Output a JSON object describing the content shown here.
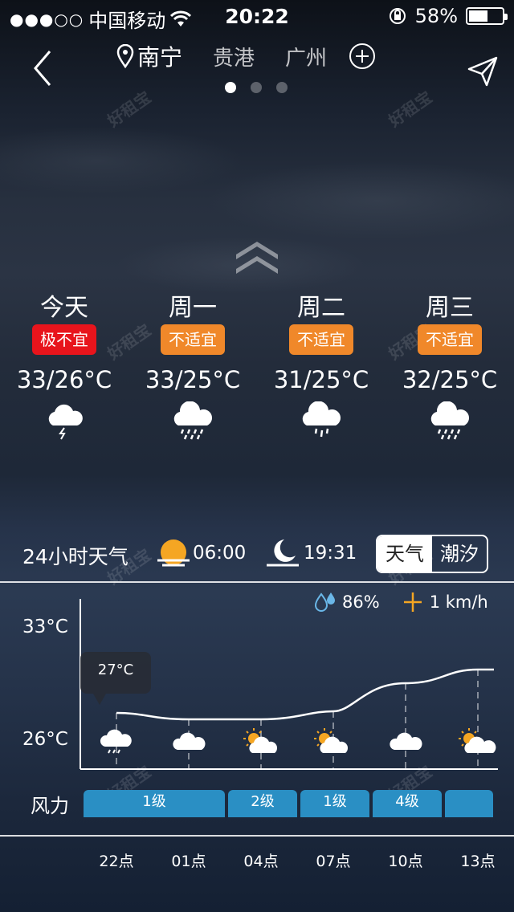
{
  "status_bar": {
    "signal": "●●●○○",
    "carrier": "中国移动",
    "time": "20:22",
    "battery": "58%",
    "battery_level": 0.58
  },
  "nav": {
    "cities": [
      "南宁",
      "贵港",
      "广州"
    ],
    "active_city_index": 0,
    "page_count": 3,
    "active_page": 0
  },
  "forecast": [
    {
      "day": "今天",
      "badge": "极不宜",
      "badge_color": "#e8141c",
      "temp": "33/26°C",
      "icon": "thunderstorm-cloud-icon"
    },
    {
      "day": "周一",
      "badge": "不适宜",
      "badge_color": "#f0882a",
      "temp": "33/25°C",
      "icon": "rain-cloud-icon"
    },
    {
      "day": "周二",
      "badge": "不适宜",
      "badge_color": "#f0882a",
      "temp": "31/25°C",
      "icon": "light-rain-cloud-icon"
    },
    {
      "day": "周三",
      "badge": "不适宜",
      "badge_color": "#f0882a",
      "temp": "32/25°C",
      "icon": "rain-cloud-icon"
    }
  ],
  "hourly": {
    "title": "24小时天气",
    "sunrise": "06:00",
    "sunset": "19:31",
    "toggle": {
      "weather": "天气",
      "tide": "潮汐",
      "selected": "weather"
    },
    "humidity": "86%",
    "wind_speed": "1 km/h",
    "y_max_label": "33°C",
    "y_min_label": "26°C",
    "tooltip": "27°C",
    "wind_label": "风力",
    "wind_levels": [
      {
        "label": "1级"
      },
      {
        "label": "2级"
      },
      {
        "label": "1级"
      },
      {
        "label": "4级"
      },
      {
        "label": ""
      }
    ],
    "times": [
      "22点",
      "01点",
      "04点",
      "07点",
      "10点",
      "13点"
    ],
    "icons": [
      "thunderstorm-cloud-icon",
      "cloudy-icon",
      "partly-sunny-icon",
      "partly-sunny-icon",
      "cloudy-icon",
      "partly-sunny-icon"
    ]
  },
  "watermark": "好租宝"
}
